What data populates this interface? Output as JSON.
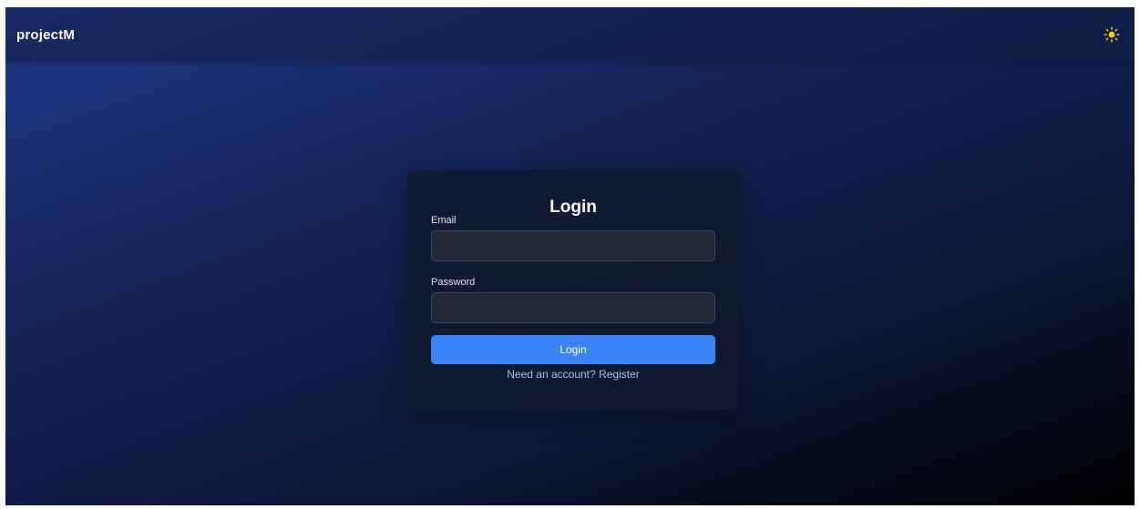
{
  "header": {
    "brand": "projectM",
    "theme_toggle_icon": "sun-icon",
    "theme_toggle_color": "#facc15"
  },
  "login_form": {
    "title": "Login",
    "email_label": "Email",
    "email_value": "",
    "password_label": "Password",
    "password_value": "",
    "submit_label": "Login",
    "register_link": "Need an account? Register"
  },
  "colors": {
    "background_start": "#1e3a8a",
    "background_end": "#000000",
    "card": "#0f172a",
    "input": "#1f2937",
    "primary_button": "#3b82f6",
    "link": "#93c5fd"
  }
}
